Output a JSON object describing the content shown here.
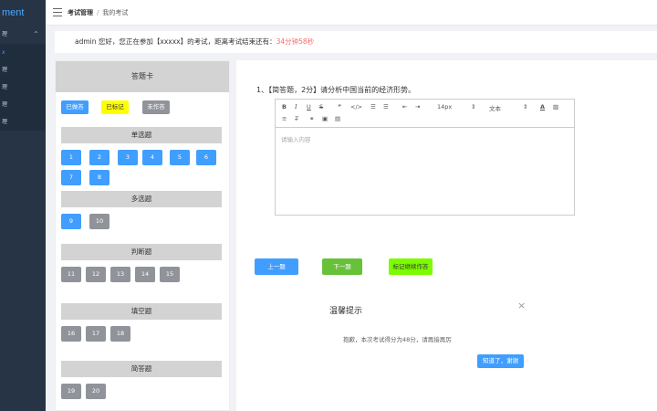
{
  "sidebar": {
    "logo": "ment",
    "menu_label": "理",
    "items": [
      "x",
      "理",
      "理",
      "理",
      "理"
    ]
  },
  "topbar": {
    "breadcrumb_1": "考试管理",
    "breadcrumb_sep": "/",
    "breadcrumb_2": "我的考试"
  },
  "notice": {
    "text": "admin 您好，您正在参加【xxxxx】的考试，距离考试结束还有：",
    "time_left": "34分钟58秒"
  },
  "answer_card": {
    "title": "答题卡",
    "legend": {
      "done": "已做答",
      "marked": "已标记",
      "todo": "未作答"
    },
    "sections": [
      {
        "name": "单选题",
        "questions": [
          {
            "n": "1",
            "state": "done"
          },
          {
            "n": "2",
            "state": "done"
          },
          {
            "n": "3",
            "state": "done"
          },
          {
            "n": "4",
            "state": "done"
          },
          {
            "n": "5",
            "state": "done"
          },
          {
            "n": "6",
            "state": "done"
          },
          {
            "n": "7",
            "state": "done"
          },
          {
            "n": "8",
            "state": "done"
          }
        ]
      },
      {
        "name": "多选题",
        "questions": [
          {
            "n": "9",
            "state": "done"
          },
          {
            "n": "10",
            "state": "todo"
          }
        ]
      },
      {
        "name": "判断题",
        "questions": [
          {
            "n": "11",
            "state": "todo"
          },
          {
            "n": "12",
            "state": "todo"
          },
          {
            "n": "13",
            "state": "todo"
          },
          {
            "n": "14",
            "state": "todo"
          },
          {
            "n": "15",
            "state": "todo"
          }
        ]
      },
      {
        "name": "填空题",
        "questions": [
          {
            "n": "16",
            "state": "todo"
          },
          {
            "n": "17",
            "state": "todo"
          },
          {
            "n": "18",
            "state": "todo"
          }
        ]
      },
      {
        "name": "简答题",
        "questions": [
          {
            "n": "19",
            "state": "todo"
          },
          {
            "n": "20",
            "state": "todo"
          }
        ]
      }
    ]
  },
  "question": {
    "title": "1、【简答题，2分】请分析中国当前的经济形势。",
    "editor": {
      "font_size": "14px",
      "block_type": "文本",
      "placeholder": "请输入内容"
    }
  },
  "buttons": {
    "prev": "上一题",
    "next": "下一题",
    "mark": "标记继续作答"
  },
  "dialog": {
    "title": "温馨提示",
    "close": "×",
    "message": "抱歉，本次考试得分为48分，请再接再厉",
    "ok": "知道了，谢谢"
  },
  "colors": {
    "primary": "#409eff",
    "success": "#67c23a",
    "warning_time": "#f56c6c",
    "marked_yellow": "#ffff00",
    "mark_button": "#7cfc00",
    "unanswered_gray": "#909399",
    "sidebar_bg": "#263445"
  }
}
